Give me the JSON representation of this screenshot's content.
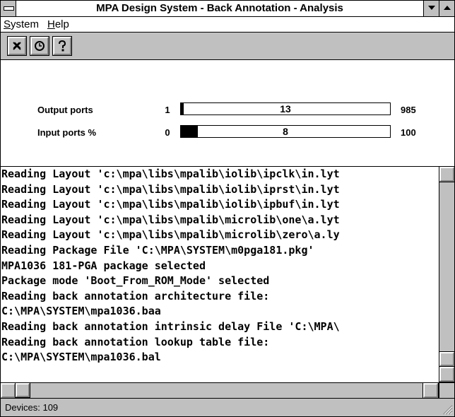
{
  "window": {
    "title": "MPA Design System - Back Annotation - Analysis"
  },
  "menu": {
    "items": [
      {
        "label": "System",
        "mnemonic": "S"
      },
      {
        "label": "Help",
        "mnemonic": "H"
      }
    ]
  },
  "toolbar": {
    "buttons": [
      {
        "icon": "close-x-icon"
      },
      {
        "icon": "clock-icon"
      },
      {
        "icon": "help-question-icon"
      }
    ]
  },
  "stats": [
    {
      "label": "Output ports",
      "min": "1",
      "value": "13",
      "max": "985",
      "progress": 0.012
    },
    {
      "label": "Input ports %",
      "min": "0",
      "value": "8",
      "max": "100",
      "progress": 0.08
    }
  ],
  "log": {
    "lines": [
      "Reading Layout 'c:\\mpa\\libs\\mpalib\\iolib\\ipclk\\in.lyt",
      "Reading Layout 'c:\\mpa\\libs\\mpalib\\iolib\\iprst\\in.lyt",
      "Reading Layout 'c:\\mpa\\libs\\mpalib\\iolib\\ipbuf\\in.lyt",
      "Reading Layout 'c:\\mpa\\libs\\mpalib\\microlib\\one\\a.lyt",
      "Reading Layout 'c:\\mpa\\libs\\mpalib\\microlib\\zero\\a.ly",
      "Reading Package File 'C:\\MPA\\SYSTEM\\m0pga181.pkg'",
      "MPA1036 181-PGA package selected",
      "Package mode 'Boot_From_ROM_Mode' selected",
      "Reading back annotation architecture file:",
      "C:\\MPA\\SYSTEM\\mpa1036.baa",
      "Reading back annotation intrinsic delay File 'C:\\MPA\\",
      "Reading back annotation lookup table file:",
      "C:\\MPA\\SYSTEM\\mpa1036.bal"
    ]
  },
  "status": {
    "text": "Devices: 109"
  }
}
